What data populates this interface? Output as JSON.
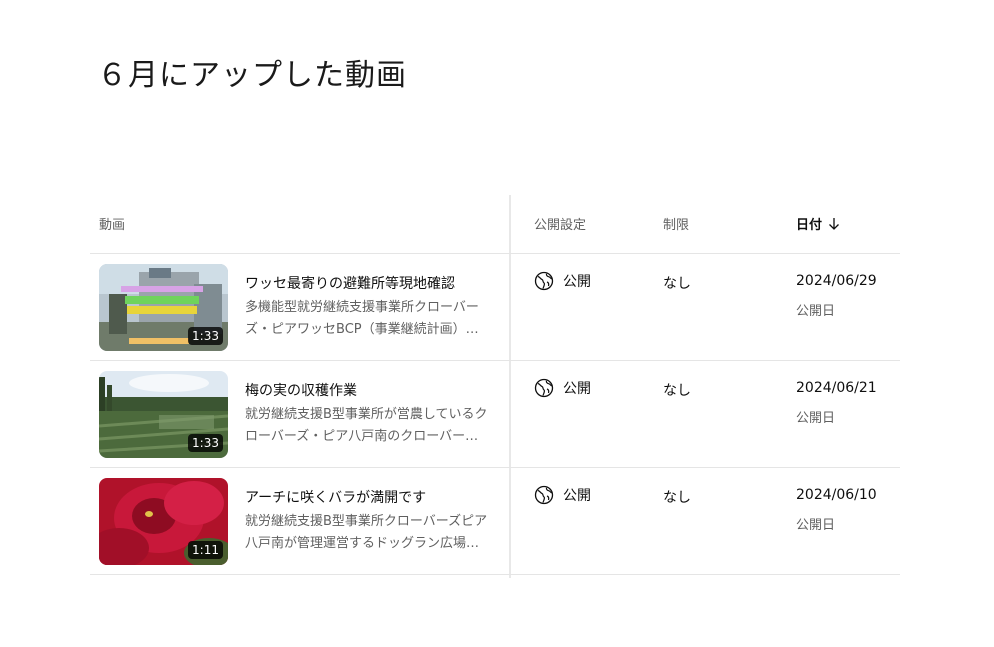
{
  "page": {
    "title": "６月にアップした動画"
  },
  "table": {
    "headers": {
      "video": "動画",
      "visibility": "公開設定",
      "restriction": "制限",
      "date": "日付"
    },
    "sort_icon": "arrow-down-icon",
    "rows": [
      {
        "thumbnail_icon": "video-thumbnail",
        "duration": "1:33",
        "title": "ワッセ最寄りの避難所等現地確認",
        "description_line1": "多機能型就労継続支援事業所クローバー",
        "description_line2": "ズ・ピアワッセBCP（事業継続計画）の…",
        "visibility_icon": "globe-icon",
        "visibility": "公開",
        "restriction": "なし",
        "date": "2024/06/29",
        "date_label": "公開日"
      },
      {
        "thumbnail_icon": "video-thumbnail",
        "duration": "1:33",
        "title": "梅の実の収穫作業",
        "description_line1": "就労継続支援B型事業所が営農しているク",
        "description_line2": "ローバーズ・ピア八戸南のクローバー農 …",
        "visibility_icon": "globe-icon",
        "visibility": "公開",
        "restriction": "なし",
        "date": "2024/06/21",
        "date_label": "公開日"
      },
      {
        "thumbnail_icon": "video-thumbnail",
        "duration": "1:11",
        "title": "アーチに咲くバラが満開です",
        "description_line1": "就労継続支援B型事業所クローバーズピア",
        "description_line2": "八戸南が管理運営するドッグラン広場に…",
        "visibility_icon": "globe-icon",
        "visibility": "公開",
        "restriction": "なし",
        "date": "2024/06/10",
        "date_label": "公開日"
      }
    ]
  }
}
